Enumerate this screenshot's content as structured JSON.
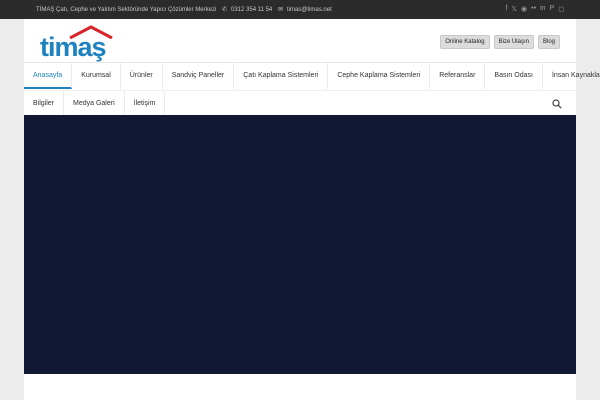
{
  "topbar": {
    "tagline": "TİMAŞ Çatı, Cephe ve Yalıtım Sektöründe Yapıcı Çözümler Merkezi",
    "phone": "0312 354 11 54",
    "email": "timas@timas.net",
    "social_icons": [
      "facebook-icon",
      "x-icon",
      "rss-icon",
      "flickr-icon",
      "linkedin-icon",
      "pinterest-icon",
      "instagram-icon"
    ]
  },
  "logo": {
    "text": "timaş",
    "color": "#1f82c0",
    "roof_color": "#d9232a"
  },
  "quick_links": [
    "Online Katalog",
    "Bize Ulaşın",
    "Blog"
  ],
  "nav": {
    "row1": [
      "Anasayfa",
      "Kurumsal",
      "Ürünler",
      "Sandviç Paneller",
      "Çatı Kaplama Sistemleri",
      "Cephe Kaplama Sistemleri",
      "Referanslar",
      "Basın Odası",
      "İnsan Kaynakları"
    ],
    "row2": [
      "Bilgiler",
      "Medya Galeri",
      "İletişim"
    ],
    "active": "Anasayfa"
  },
  "colors": {
    "accent": "#1f82c0",
    "hero": "#111833",
    "topbar": "#2b2b2b"
  }
}
